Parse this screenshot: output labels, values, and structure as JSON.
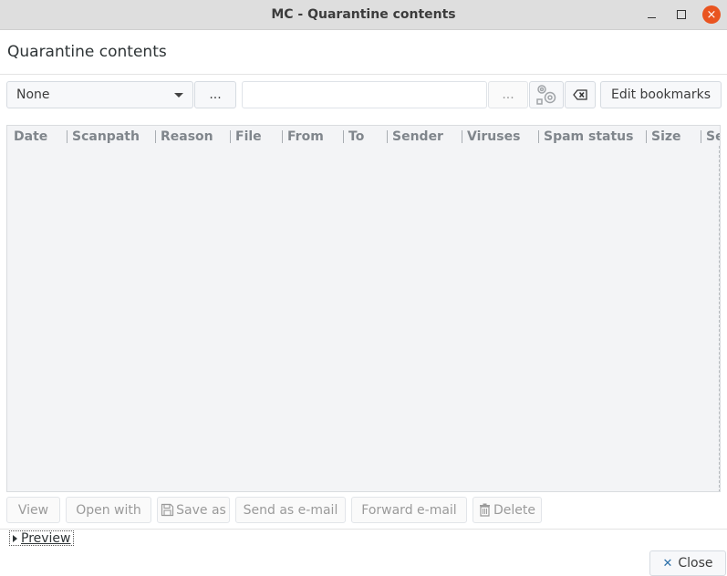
{
  "window": {
    "title": "MC - Quarantine contents",
    "controls": {
      "minimize": "minimize",
      "maximize": "maximize",
      "close": "×"
    }
  },
  "page": {
    "heading": "Quarantine contents"
  },
  "toolbar": {
    "filter_select": {
      "selected": "None"
    },
    "filter_more_label": "...",
    "search_input": {
      "value": "",
      "placeholder": ""
    },
    "search_more_label": "...",
    "edit_bookmarks_label": "Edit bookmarks"
  },
  "table": {
    "columns": [
      "Date",
      "Scanpath",
      "Reason",
      "File",
      "From",
      "To",
      "Sender",
      "Viruses",
      "Spam status",
      "Size",
      "Se"
    ],
    "rows": []
  },
  "actions": {
    "view": "View",
    "open_with": "Open with",
    "save_as": "Save as",
    "send_as_email": "Send as e-mail",
    "forward_email": "Forward e-mail",
    "delete": "Delete"
  },
  "preview_label": "Preview",
  "close_label": "Close",
  "colors": {
    "close_accent": "#e95420",
    "icon_blue": "#2a6fa8"
  }
}
